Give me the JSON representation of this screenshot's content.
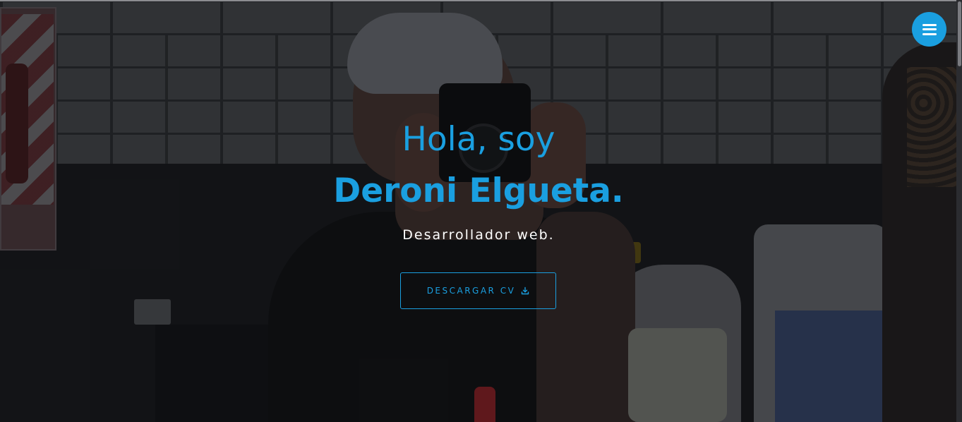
{
  "hero": {
    "greeting": "Hola, soy",
    "name": "Deroni Elgueta.",
    "role": "Desarrollador web.",
    "cv_button_label": "DESCARGAR CV",
    "cv_button_icon": "download-icon",
    "background_image": "portrait photo: person holding a Nikon camera in a barbershop"
  },
  "nav": {
    "menu_icon": "hamburger-menu-icon"
  },
  "colors": {
    "accent": "#1a9fe0",
    "text_light": "#ffffff",
    "overlay": "#0c0d10"
  }
}
